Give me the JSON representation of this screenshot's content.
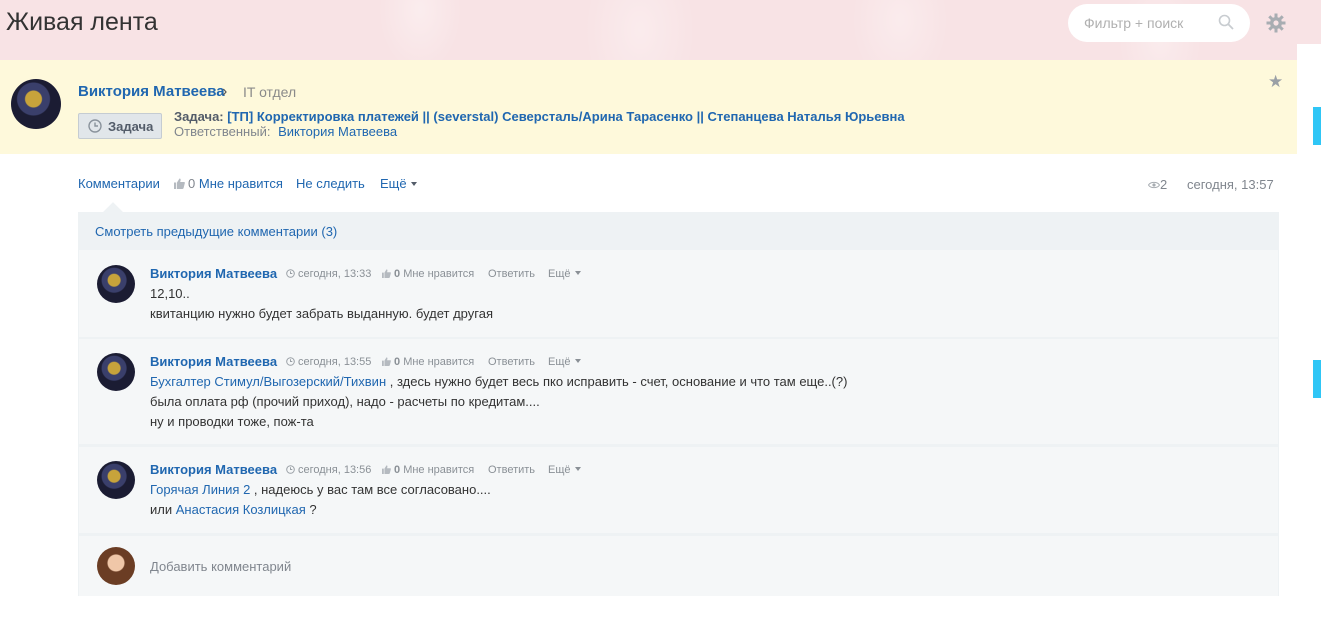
{
  "page": {
    "title": "Живая лента"
  },
  "search": {
    "placeholder": "Фильтр + поиск"
  },
  "post": {
    "author": "Виктория Матвеева",
    "group": "IT отдел",
    "badge": "Задача",
    "task_prefix": "Задача:",
    "task_title": "[ТП] Корректировка платежей || (severstal) Северсталь/Арина Тарасенко || Степанцева Наталья Юрьевна",
    "responsible_label": "Ответственный:",
    "responsible_name": "Виктория Матвеева",
    "actions": {
      "comments": "Комментарии",
      "likes_count": "0",
      "likes_label": "Мне нравится",
      "unfollow": "Не следить",
      "more": "Ещё"
    },
    "views": "2",
    "date": "сегодня, 13:57"
  },
  "comments": {
    "prev_link": "Смотреть предыдущие комментарии (3)",
    "items": [
      {
        "author": "Виктория Матвеева",
        "time": "сегодня, 13:33",
        "likes_count": "0",
        "likes_label": "Мне нравится",
        "reply": "Ответить",
        "more": "Ещё",
        "line1": "12,10..",
        "line2": "квитанцию нужно будет забрать выданную. будет другая"
      },
      {
        "author": "Виктория Матвеева",
        "time": "сегодня, 13:55",
        "likes_count": "0",
        "likes_label": "Мне нравится",
        "reply": "Ответить",
        "more": "Ещё",
        "mention": "Бухгалтер Стимул/Выгозерский/Тихвин",
        "line1_rest": " , здесь нужно будет весь пко исправить - счет, основание и что там еще..(?)",
        "line2": "была оплата рф (прочий приход), надо - расчеты по кредитам....",
        "line3": "ну и проводки тоже, пож-та"
      },
      {
        "author": "Виктория Матвеева",
        "time": "сегодня, 13:56",
        "likes_count": "0",
        "likes_label": "Мне нравится",
        "reply": "Ответить",
        "more": "Ещё",
        "mention1": "Горячая Линия 2",
        "line1_rest": " , надеюсь у вас там все согласовано....",
        "line2_prefix": "или ",
        "mention2": "Анастасия Козлицкая",
        "line2_rest": " ?"
      }
    ],
    "add_placeholder": "Добавить комментарий"
  },
  "colors": {
    "link": "#2067b0",
    "header_bg": "#fef9db",
    "accent_tab": "#2fc6f6"
  },
  "icons": [
    "search-icon",
    "gear-icon",
    "star-icon",
    "clock-icon",
    "thumb-up-icon",
    "eye-icon",
    "chevron-right-icon",
    "caret-down-icon"
  ]
}
